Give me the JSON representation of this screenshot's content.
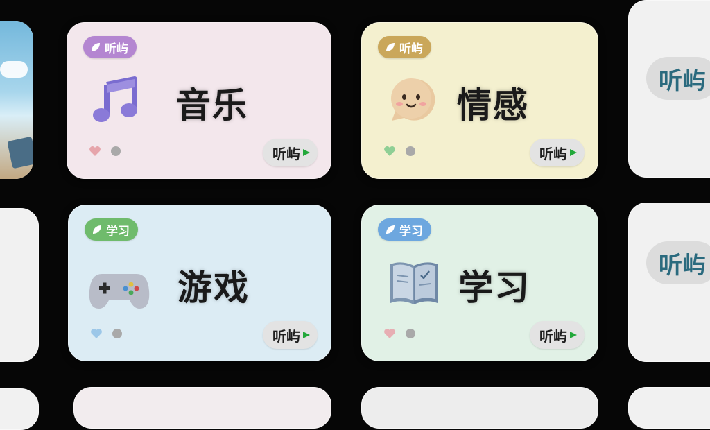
{
  "cards": [
    {
      "tag": "听屿",
      "title": "音乐",
      "brand": "听屿",
      "tag_color": "#b486d1",
      "bg": "#f3e7ec",
      "heart_color": "#e6a5ab",
      "icon": "music-note-icon"
    },
    {
      "tag": "听屿",
      "title": "情感",
      "brand": "听屿",
      "tag_color": "#caa75a",
      "bg": "#f4f0cf",
      "heart_color": "#8fcf95",
      "icon": "smiley-speech-bubble-icon"
    },
    {
      "tag": "学习",
      "title": "游戏",
      "brand": "听屿",
      "tag_color": "#6fbb6c",
      "bg": "#dcecf4",
      "heart_color": "#9cc7e8",
      "icon": "gamepad-icon"
    },
    {
      "tag": "学习",
      "title": "学习",
      "brand": "听屿",
      "tag_color": "#6da7df",
      "bg": "#e1f1e6",
      "heart_color": "#e7aeb3",
      "icon": "open-book-icon"
    }
  ],
  "side_right": {
    "brand": "听屿"
  }
}
